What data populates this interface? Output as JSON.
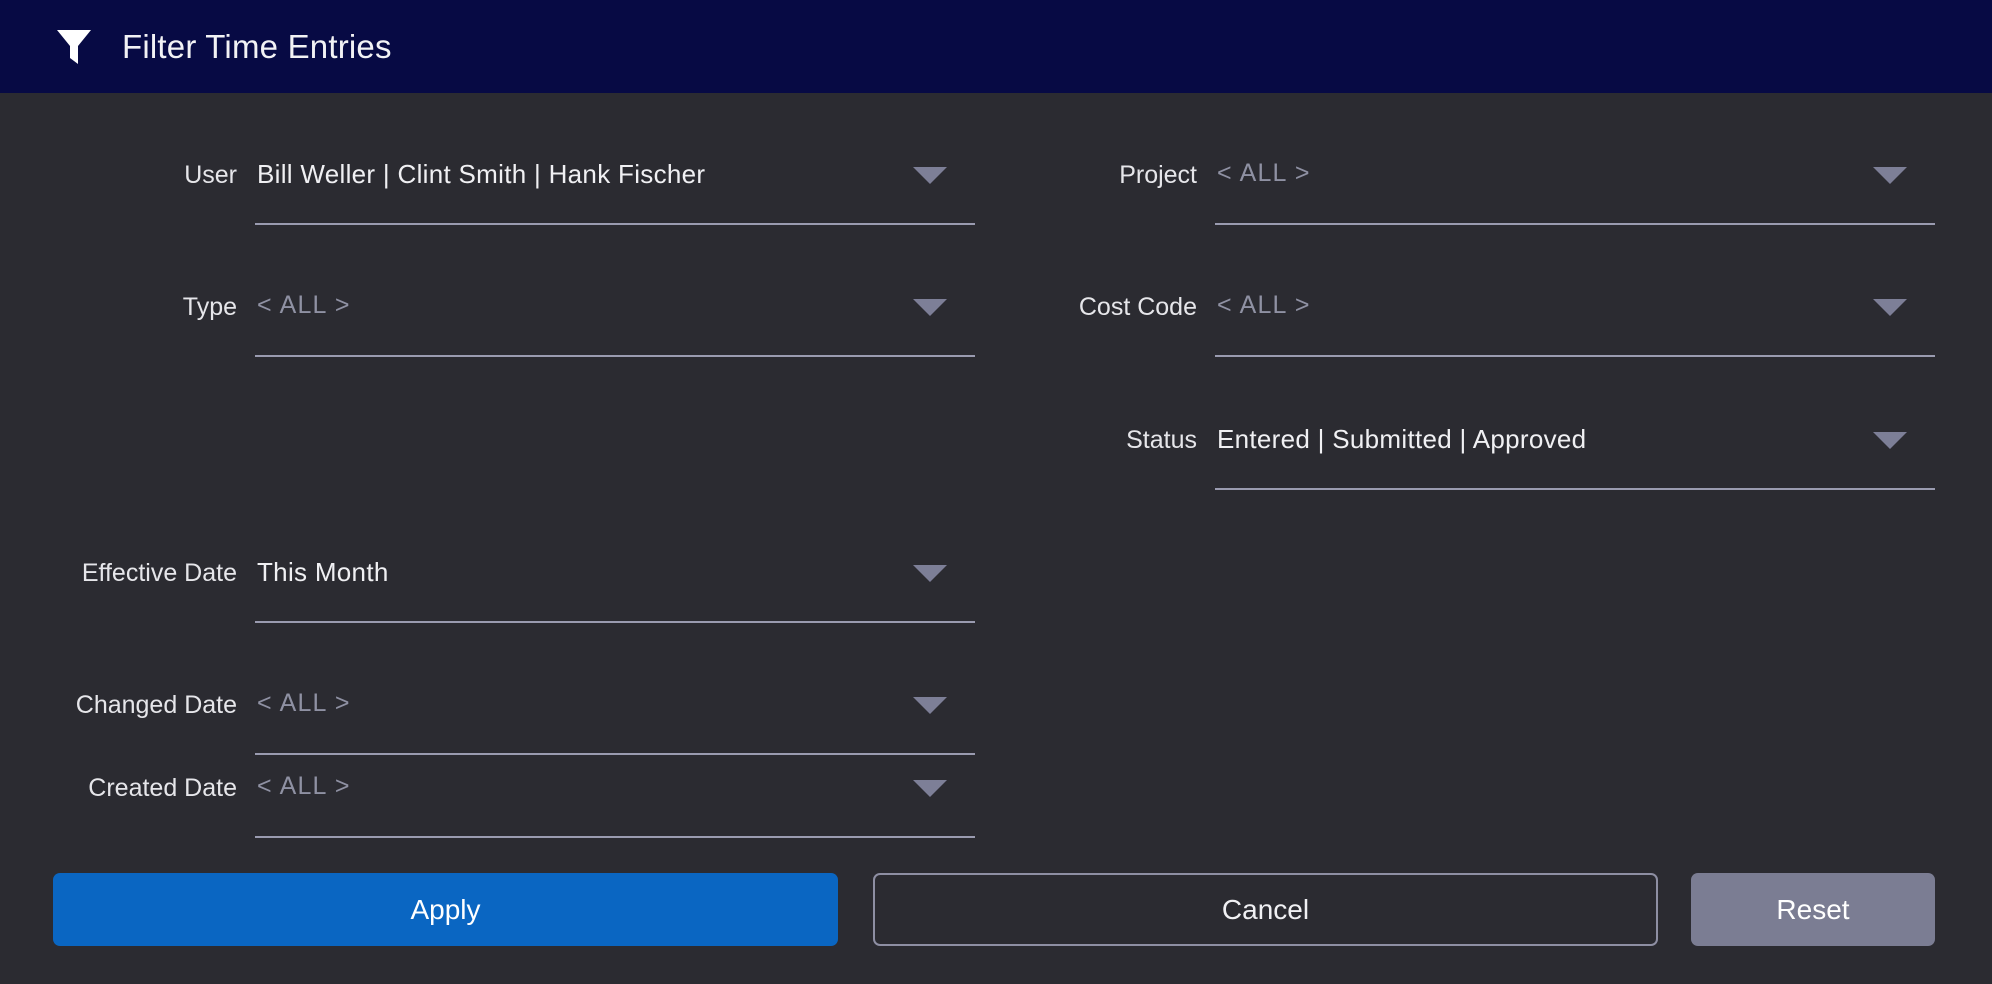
{
  "header": {
    "icon": "funnel-filter-icon",
    "title": "Filter Time Entries",
    "background_color": "#070A44"
  },
  "colors": {
    "dialog_background": "#2B2B31",
    "header_background": "#070A44",
    "underline": "#9A9BB0",
    "arrow": "#7D7F97",
    "placeholder_text": "#8F91A3",
    "value_text": "#F0F0F3",
    "apply_button": "#0A66C2",
    "reset_button": "#7B7D93",
    "cancel_border": "#8E8FA3"
  },
  "form": {
    "left_column": [
      {
        "label": "User",
        "value": "Bill Weller  |  Clint Smith  |  Hank Fischer",
        "is_placeholder": false,
        "icon": "chevron-down-icon"
      },
      {
        "label": "Type",
        "value": "< ALL >",
        "is_placeholder": true,
        "icon": "chevron-down-icon"
      },
      {
        "label": "Effective Date",
        "value": "This Month",
        "is_placeholder": false,
        "icon": "chevron-down-icon"
      },
      {
        "label": "Changed Date",
        "value": "< ALL >",
        "is_placeholder": true,
        "icon": "chevron-down-icon"
      },
      {
        "label": "Created Date",
        "value": "< ALL >",
        "is_placeholder": true,
        "icon": "chevron-down-icon"
      }
    ],
    "right_column": [
      {
        "label": "Project",
        "value": "< ALL >",
        "is_placeholder": true,
        "icon": "chevron-down-icon"
      },
      {
        "label": "Cost Code",
        "value": "< ALL >",
        "is_placeholder": true,
        "icon": "chevron-down-icon"
      },
      {
        "label": "Status",
        "value": "Entered  |  Submitted  |  Approved",
        "is_placeholder": false,
        "icon": "chevron-down-icon"
      }
    ]
  },
  "footer": {
    "apply_label": "Apply",
    "cancel_label": "Cancel",
    "reset_label": "Reset"
  }
}
